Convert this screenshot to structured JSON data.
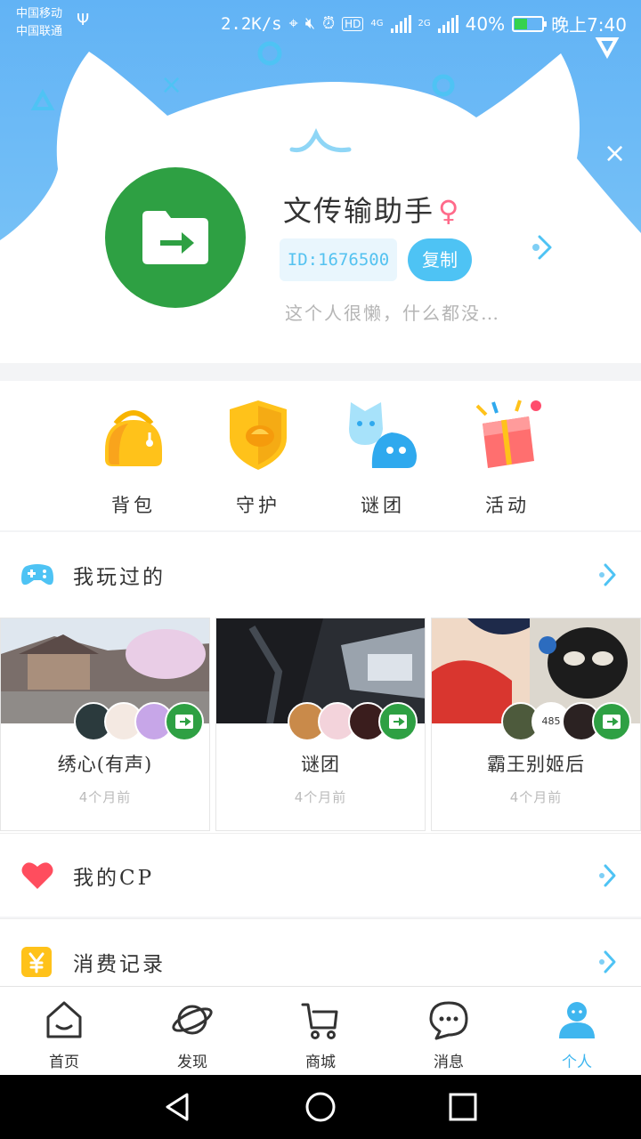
{
  "status_bar": {
    "carrier1": "中国移动",
    "carrier2": "中国联通",
    "speed": "2.2K/s",
    "net1": "4G",
    "net2": "2G",
    "battery": "40%",
    "time": "晚上7:40"
  },
  "profile": {
    "name": "文传输助手",
    "gender": "♀",
    "id": "ID:1676500",
    "copy_label": "复制",
    "bio": "这个人很懒，什么都没…"
  },
  "quick_actions": [
    {
      "label": "背包",
      "icon": "backpack-icon"
    },
    {
      "label": "守护",
      "icon": "shield-icon"
    },
    {
      "label": "谜团",
      "icon": "mystery-group-icon"
    },
    {
      "label": "活动",
      "icon": "gift-box-icon"
    }
  ],
  "played": {
    "title": "我玩过的",
    "cards": [
      {
        "name": "绣心(有声)",
        "time": "4个月前"
      },
      {
        "name": "谜团",
        "time": "4个月前"
      },
      {
        "name": "霸王别姬后",
        "time": "4个月前",
        "member_count": "485"
      }
    ]
  },
  "rows": {
    "cp": "我的CP",
    "spending": "消费记录"
  },
  "bottom_nav": [
    {
      "label": "首页",
      "icon": "home-icon"
    },
    {
      "label": "发现",
      "icon": "planet-icon"
    },
    {
      "label": "商城",
      "icon": "cart-icon"
    },
    {
      "label": "消息",
      "icon": "chat-bubble-icon"
    },
    {
      "label": "个人",
      "icon": "person-icon",
      "active": true
    }
  ],
  "colors": {
    "accent": "#4ec3f4",
    "avatar_bg": "#2ea043",
    "header_bg": "#6ab9f5"
  }
}
